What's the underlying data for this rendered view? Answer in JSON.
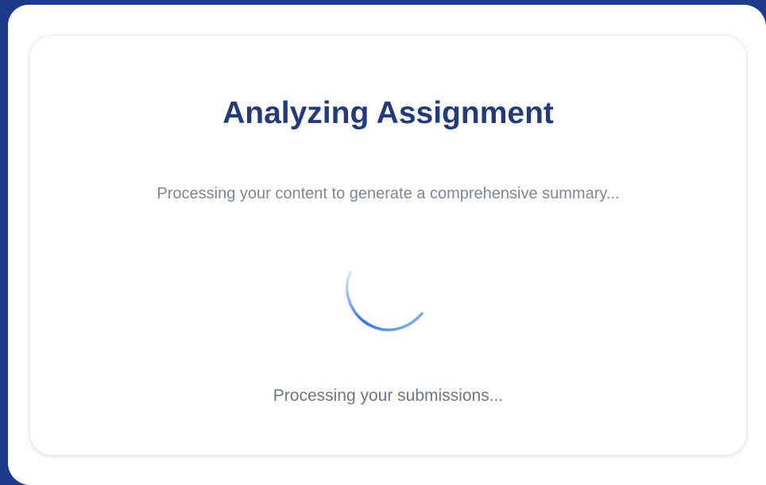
{
  "dialog": {
    "title": "Analyzing Assignment",
    "subtitle": "Processing your content to generate a comprehensive summary...",
    "status": "Processing your submissions...",
    "spinner_icon": "loading-spinner-icon"
  },
  "colors": {
    "background": "#1e3a8a",
    "title": "#243b7a",
    "text_muted": "#7d8597",
    "spinner": "#2f6ee6"
  }
}
